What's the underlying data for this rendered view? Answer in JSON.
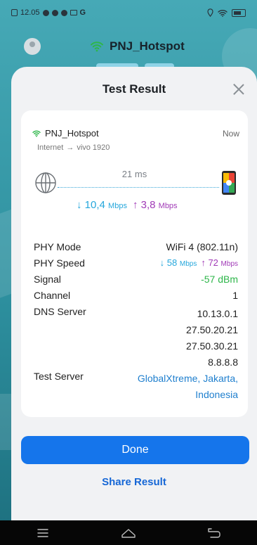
{
  "status_bar": {
    "time": "12.05",
    "carrier_glyph": "G"
  },
  "app_header": {
    "ssid": "PNJ_Hotspot"
  },
  "sheet": {
    "title": "Test Result",
    "card": {
      "ssid": "PNJ_Hotspot",
      "route_from": "Internet",
      "route_arrow": "→",
      "route_to": "vivo 1920",
      "timestamp": "Now",
      "latency": "21 ms",
      "download": {
        "arrow": "↓",
        "value": "10,4",
        "unit": "Mbps"
      },
      "upload": {
        "arrow": "↑",
        "value": "3,8",
        "unit": "Mbps"
      },
      "rows": [
        {
          "label": "PHY Mode",
          "value": "WiFi 4 (802.11n)"
        },
        {
          "label": "PHY Speed"
        },
        {
          "label": "Signal",
          "value": "-57 dBm"
        },
        {
          "label": "Channel",
          "value": "1"
        },
        {
          "label": "DNS Server",
          "values": [
            "10.13.0.1",
            "27.50.20.21",
            "27.50.30.21",
            "8.8.8.8"
          ]
        },
        {
          "label": "Test Server",
          "value_line1": "GlobalXtreme, Jakarta,",
          "value_line2": "Indonesia"
        }
      ],
      "phy_speed": {
        "down_arrow": "↓",
        "down_value": "58",
        "down_unit": "Mbps",
        "up_arrow": "↑",
        "up_value": "72",
        "up_unit": "Mbps"
      }
    },
    "done_label": "Done",
    "share_label": "Share Result"
  },
  "colors": {
    "accent": "#1575eb",
    "download": "#26a7dc",
    "upload": "#a13bb7",
    "signal_good": "#2eb64a",
    "link": "#1f7fce"
  },
  "icons": [
    "wifi-icon",
    "globe-icon",
    "phone-icon",
    "close-icon",
    "menu-icon",
    "home-icon",
    "back-icon"
  ]
}
